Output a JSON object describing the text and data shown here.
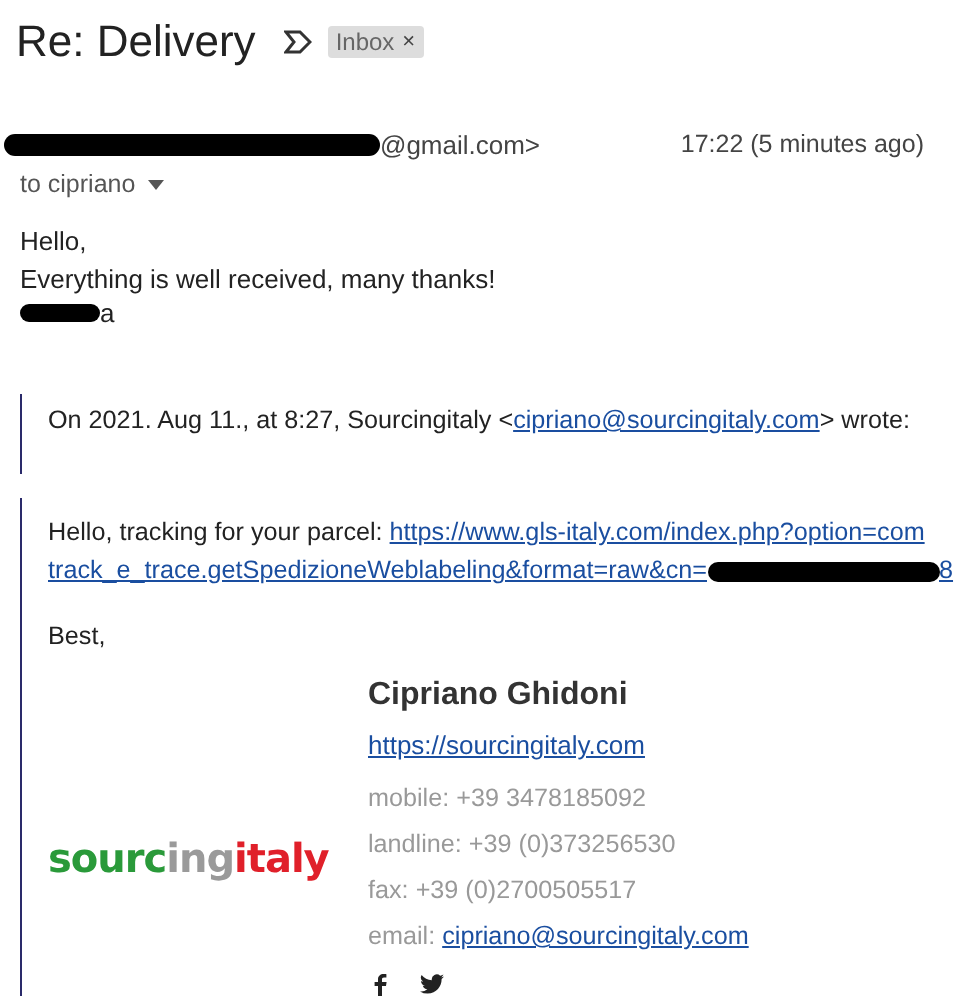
{
  "subject": "Re: Delivery",
  "label": {
    "text": "Inbox",
    "remove": "×"
  },
  "sender": {
    "address": "@gmail.com>",
    "time": "17:22 (5 minutes ago)"
  },
  "recipient": "to cipriano",
  "body": [
    "Hello,",
    "Everything is well received, many thanks!"
  ],
  "signoff": "a",
  "quote_header": {
    "prefix": "On 2021. Aug 11., at 8:27, Sourcingitaly <",
    "email": "cipriano@sourcingitaly.com",
    "suffix": "> wrote:"
  },
  "quoted": {
    "intro": "Hello, tracking for your parcel: ",
    "link_line_1": "https://www.gls-italy.com/index.php?option=com",
    "link_line_2": "track_e_trace.getSpedizioneWeblabeling&format=raw&cn=",
    "link_tail": "8",
    "closing": "Best,"
  },
  "signature": {
    "logo": [
      {
        "text": "sourc",
        "color": "#2a9a3a"
      },
      {
        "text": "ing",
        "color": "#9a9a9a"
      },
      {
        "text": "italy",
        "color": "#e0202a"
      }
    ],
    "name": "Cipriano Ghidoni",
    "website": "https://sourcingitaly.com",
    "contacts": [
      {
        "label": "mobile:",
        "value": "+39 3478185092"
      },
      {
        "label": "landline:",
        "value": "+39 (0)373256530"
      },
      {
        "label": "fax:",
        "value": "+39 (0)2700505517"
      },
      {
        "label": "email:",
        "value": "cipriano@sourcingitaly.com",
        "kind": "link"
      }
    ]
  }
}
